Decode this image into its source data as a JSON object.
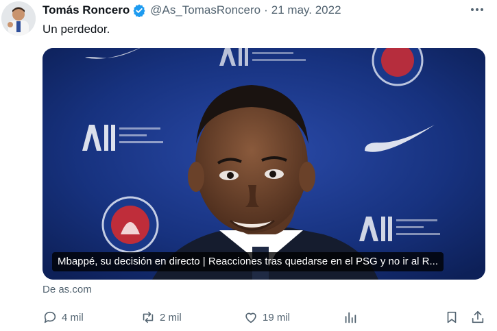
{
  "tweet": {
    "author_name": "Tomás Roncero",
    "handle": "@As_TomasRoncero",
    "separator": "·",
    "date": "21 may. 2022",
    "text": "Un perdedor.",
    "verified": true
  },
  "card": {
    "caption": "Mbappé, su decisión en directo | Reacciones tras quedarse en el PSG y no ir al R...",
    "source": "De as.com",
    "background_color": "#16307a"
  },
  "actions": {
    "replies": "4 mil",
    "retweets": "2 mil",
    "likes": "19 mil"
  },
  "icons": [
    "more-icon",
    "verified-icon",
    "reply-icon",
    "retweet-icon",
    "like-icon",
    "views-icon",
    "bookmark-icon",
    "share-icon"
  ],
  "colors": {
    "verified": "#1d9bf0",
    "muted": "#536471",
    "text": "#0f1419"
  }
}
